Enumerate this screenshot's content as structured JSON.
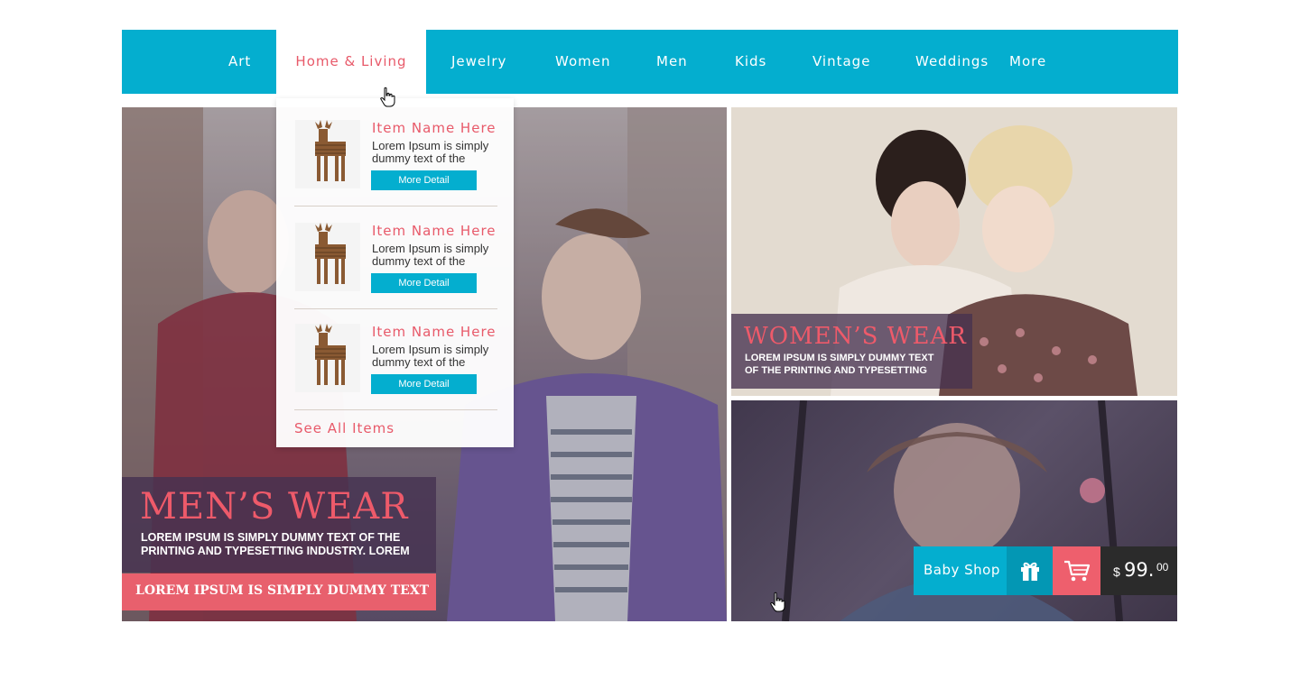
{
  "nav": {
    "items": [
      "Art",
      "Home & Living",
      "Jewelry",
      "Women",
      "Men",
      "Kids",
      "Vintage",
      "Weddings",
      "More"
    ],
    "active": "Home & Living"
  },
  "dropdown": {
    "items": [
      {
        "name": "Item Name Here",
        "desc": "Lorem Ipsum is simply dummy text of the",
        "button": "More Detail"
      },
      {
        "name": "Item Name Here",
        "desc": "Lorem Ipsum is simply dummy text of the",
        "button": "More Detail"
      },
      {
        "name": "Item Name Here",
        "desc": "Lorem Ipsum is simply dummy text of the",
        "button": "More Detail"
      }
    ],
    "see_all": "See All Items"
  },
  "men": {
    "title": "MEN’S WEAR",
    "subtitle_line1": "LOREM IPSUM IS SIMPLY DUMMY TEXT OF THE",
    "subtitle_line2": "PRINTING AND TYPESETTING INDUSTRY. LOREM",
    "banner": "LOREM IPSUM IS SIMPLY DUMMY TEXT"
  },
  "women": {
    "title": "WOMEN’S WEAR",
    "subtitle_line1": "LOREM IPSUM IS SIMPLY DUMMY TEXT",
    "subtitle_line2": "OF THE PRINTING AND TYPESETTING"
  },
  "kids": {
    "shop_label": "Baby Shop",
    "currency": "$",
    "price_main": "99.",
    "price_cents": "00"
  },
  "colors": {
    "primary": "#04aecf",
    "accent": "#e85a6a",
    "overlay": "#463250",
    "price_bg": "#2b2b2b"
  },
  "icons": [
    "pointer-cursor-icon",
    "gift-icon",
    "cart-icon",
    "deer-figurine-thumbnail"
  ]
}
